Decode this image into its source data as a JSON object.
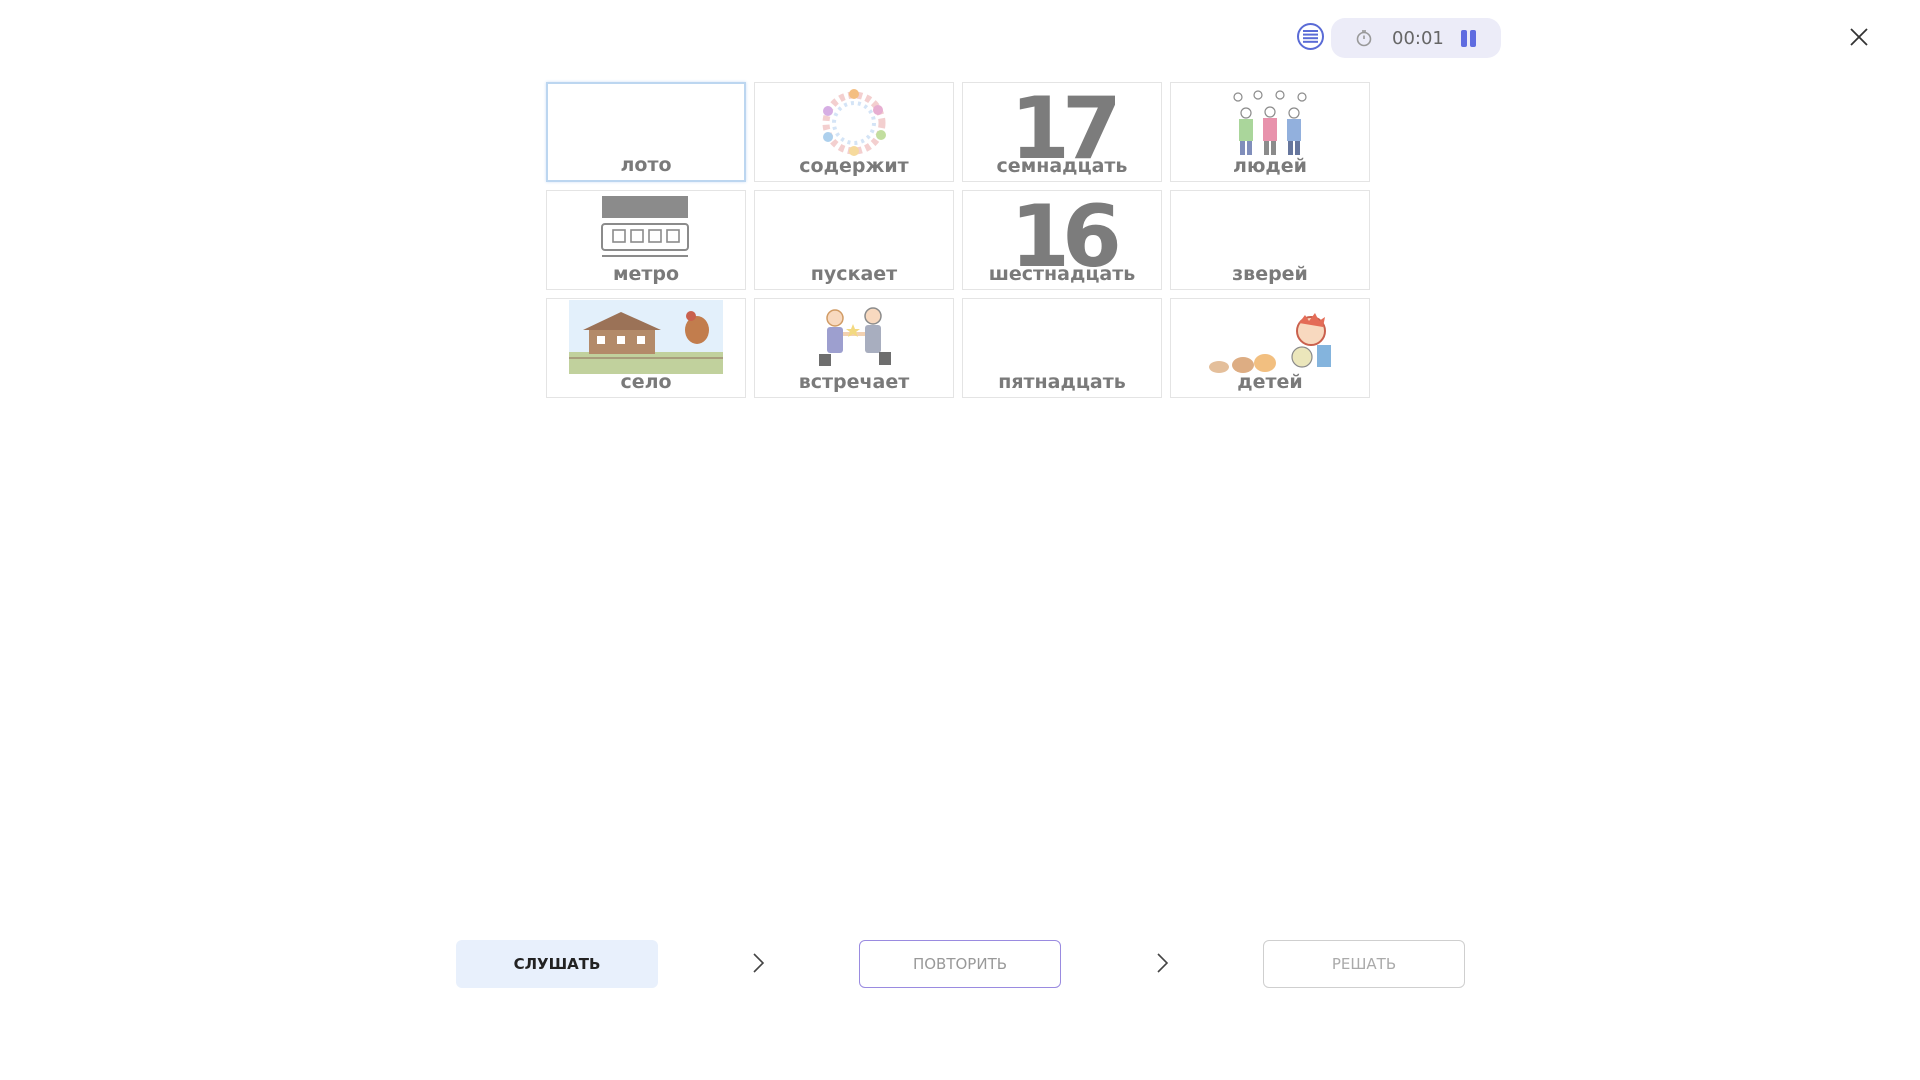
{
  "header": {
    "timer": "00:01",
    "menu_icon": "list-icon",
    "clock_icon": "stopwatch-icon",
    "pause_icon": "pause-icon",
    "close_icon": "close-icon"
  },
  "cards": [
    {
      "label": "лото",
      "picture": "blank",
      "selected": true
    },
    {
      "label": "содержит",
      "picture": "food-ring-illustration"
    },
    {
      "label": "семнадцать",
      "picture": "17"
    },
    {
      "label": "людей",
      "picture": "group-of-people-illustration"
    },
    {
      "label": "метро",
      "picture": "metro-train-illustration"
    },
    {
      "label": "пускает",
      "picture": "blank"
    },
    {
      "label": "шестнадцать",
      "picture": "16"
    },
    {
      "label": "зверей",
      "picture": "blank"
    },
    {
      "label": "село",
      "picture": "village-photo"
    },
    {
      "label": "встречает",
      "picture": "handshake-illustration"
    },
    {
      "label": "пятнадцать",
      "picture": "blank"
    },
    {
      "label": "детей",
      "picture": "children-illustration"
    }
  ],
  "steps": {
    "listen": "СЛУШАТЬ",
    "repeat": "ПОВТОРИТЬ",
    "solve": "РЕШАТЬ"
  },
  "colors": {
    "accent": "#5f6ce0",
    "listen_bg": "#e8f0fc",
    "selected_border": "#bcd6f0"
  }
}
